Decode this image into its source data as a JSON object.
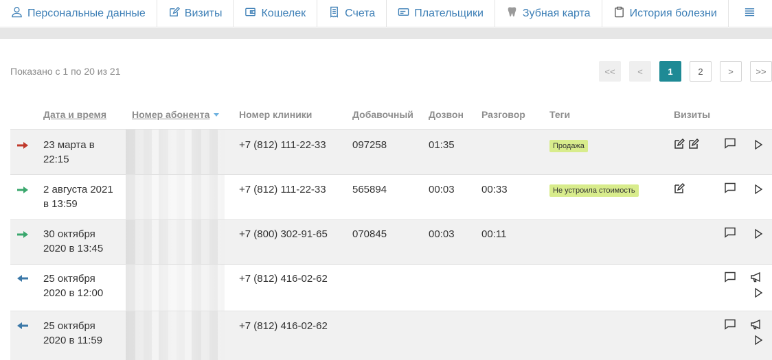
{
  "nav": {
    "tabs": [
      {
        "label": "Персональные данные",
        "icon": "user-icon"
      },
      {
        "label": "Визиты",
        "icon": "edit-icon"
      },
      {
        "label": "Кошелек",
        "icon": "wallet-icon"
      },
      {
        "label": "Счета",
        "icon": "invoice-icon"
      },
      {
        "label": "Плательщики",
        "icon": "card-icon"
      },
      {
        "label": "Зубная карта",
        "icon": "tooth-icon"
      },
      {
        "label": "История болезни",
        "icon": "clipboard-icon"
      }
    ],
    "menu_icon": "hamburger-icon"
  },
  "showing_text": "Показано с 1 по 20 из 21",
  "pagination": {
    "first": "<<",
    "prev": "<",
    "pages": [
      "1",
      "2"
    ],
    "current": "1",
    "next": ">",
    "last": ">>"
  },
  "table": {
    "headers": {
      "datetime": "Дата и время",
      "subscriber": "Номер абонента",
      "clinic": "Номер клиники",
      "extension": "Добавочный",
      "dialing": "Дозвон",
      "talk": "Разговор",
      "tags": "Теги",
      "visits": "Визиты"
    },
    "rows": [
      {
        "direction": "missed",
        "arrow_color": "#c0392b",
        "date_line1": "23 марта в",
        "date_line2": "22:15",
        "clinic": "+7 (812) 111-22-33",
        "extension": "097258",
        "dialing": "01:35",
        "talk": "",
        "tag": "Продажа",
        "visits": 2
      },
      {
        "direction": "incoming",
        "arrow_color": "#3aa76d",
        "date_line1": "2 августа 2021",
        "date_line2": "в 13:59",
        "clinic": "+7 (812) 111-22-33",
        "extension": "565894",
        "dialing": "00:03",
        "talk": "00:33",
        "tag": "Не устроила стоимость",
        "visits": 1
      },
      {
        "direction": "incoming",
        "arrow_color": "#3aa76d",
        "date_line1": "30 октября",
        "date_line2": "2020 в 13:45",
        "clinic": "+7 (800) 302-91-65",
        "extension": "070845",
        "dialing": "00:03",
        "talk": "00:11",
        "tag": "",
        "visits": 0
      },
      {
        "direction": "outgoing",
        "arrow_color": "#3b78a8",
        "date_line1": "25 октября",
        "date_line2": "2020 в 12:00",
        "clinic": "+7 (812) 416-02-62",
        "extension": "",
        "dialing": "",
        "talk": "",
        "tag": "",
        "visits": 0
      },
      {
        "direction": "outgoing",
        "arrow_color": "#3b78a8",
        "date_line1": "25 октября",
        "date_line2": "2020 в 11:59",
        "clinic": "+7 (812) 416-02-62",
        "extension": "",
        "dialing": "",
        "talk": "",
        "tag": "",
        "visits": 0
      }
    ]
  },
  "colors": {
    "link": "#3d7fb6",
    "active_page": "#1e8a95",
    "tag_bg": "#d8ec8c"
  }
}
